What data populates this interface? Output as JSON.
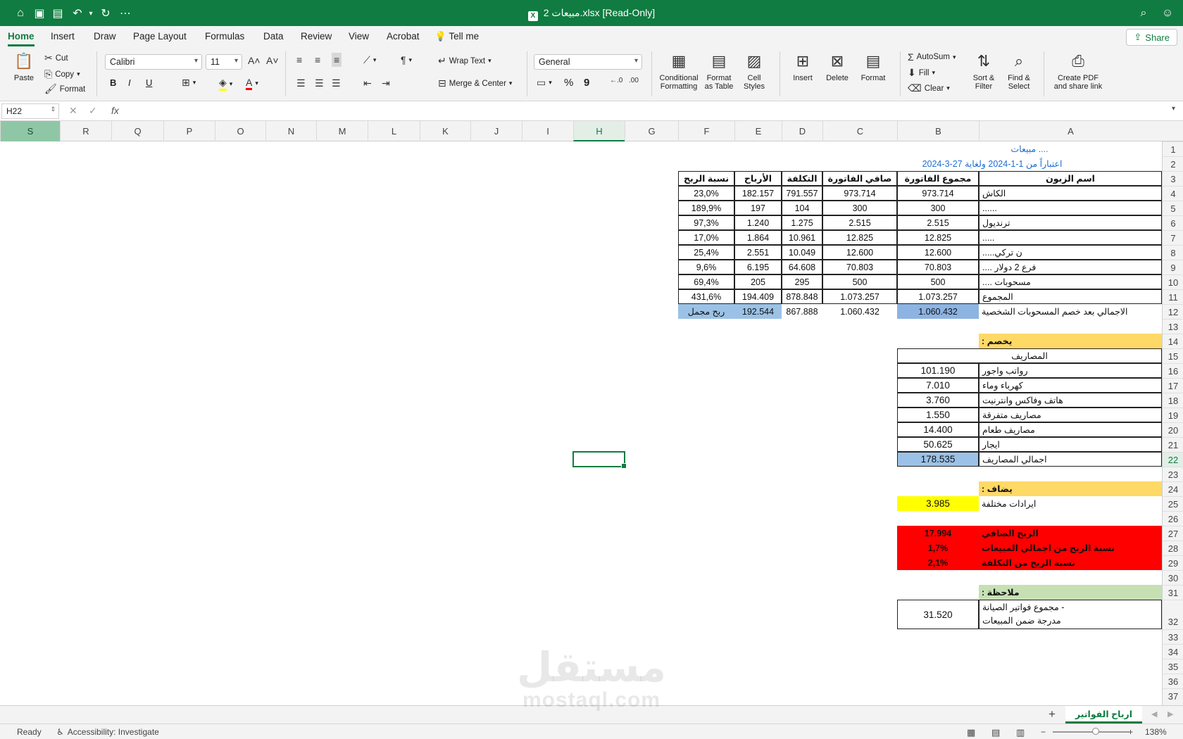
{
  "titlebar": {
    "title": "مبيعات 2.xlsx  [Read-Only]",
    "icons": [
      "home-icon",
      "save-icon",
      "save-as-icon",
      "undo-icon",
      "redo-icon",
      "more-icon",
      "search-icon",
      "account-icon"
    ]
  },
  "menu": {
    "tabs": [
      "Home",
      "Insert",
      "Draw",
      "Page Layout",
      "Formulas",
      "Data",
      "Review",
      "View",
      "Acrobat"
    ],
    "tell_me": "Tell me",
    "share": "Share"
  },
  "ribbon": {
    "paste": "Paste",
    "cut": "Cut",
    "copy": "Copy",
    "format": "Format",
    "font_name": "Calibri",
    "font_size": "11",
    "bold": "B",
    "italic": "I",
    "underline": "U",
    "wrap_text": "Wrap Text",
    "merge_center": "Merge & Center",
    "number_format": "General",
    "percent": "%",
    "comma": "9",
    "conditional_formatting": "Conditional Formatting",
    "format_as_table": "Format as Table",
    "cell_styles": "Cell Styles",
    "insert": "Insert",
    "delete": "Delete",
    "format_cells": "Format",
    "autosum": "AutoSum",
    "fill": "Fill",
    "clear": "Clear",
    "sort_filter": "Sort & Filter",
    "find_select": "Find & Select",
    "create_pdf": "Create PDF and share link"
  },
  "formula": {
    "name_box": "H22",
    "fx": "fx",
    "content": ""
  },
  "columns": [
    "S",
    "R",
    "Q",
    "P",
    "O",
    "N",
    "M",
    "L",
    "K",
    "J",
    "I",
    "H",
    "G",
    "F",
    "E",
    "D",
    "C",
    "B",
    "A"
  ],
  "rows": [
    "1",
    "2",
    "3",
    "4",
    "5",
    "6",
    "7",
    "8",
    "9",
    "10",
    "11",
    "12",
    "13",
    "14",
    "15",
    "16",
    "17",
    "18",
    "19",
    "20",
    "21",
    "22",
    "23",
    "24",
    "25",
    "26",
    "27",
    "28",
    "29",
    "30",
    "31",
    "32",
    "33",
    "34",
    "35",
    "36",
    "37"
  ],
  "selected_cell": "H22",
  "sheet": {
    "title": "مبيعات ....",
    "subtitle": "اعتباراً من  1-1-2024 ولغاية  27-3-2024",
    "headers": [
      "اسم الزبون",
      "مجموع الفاتورة",
      "صافي الفاتورة",
      "التكلفة",
      "الأرباح",
      "نسبة الربح"
    ],
    "sales_rows": [
      [
        "الكاش",
        "973.714",
        "973.714",
        "791.557",
        "182.157",
        "23,0%"
      ],
      [
        "......",
        "300",
        "300",
        "104",
        "197",
        "189,9%"
      ],
      [
        "ترنديول",
        "2.515",
        "2.515",
        "1.275",
        "1.240",
        "97,3%"
      ],
      [
        ".....",
        "12.825",
        "12.825",
        "10.961",
        "1.864",
        "17,0%"
      ],
      [
        "ن تركي.....",
        "12.600",
        "12.600",
        "10.049",
        "2.551",
        "25,4%"
      ],
      [
        "فرع 2 دولار ....",
        "70.803",
        "70.803",
        "64.608",
        "6.195",
        "9,6%"
      ],
      [
        "مسحوبات ....",
        "500",
        "500",
        "295",
        "205",
        "69,4%"
      ],
      [
        "المجموع",
        "1.073.257",
        "1.073.257",
        "878.848",
        "194.409",
        "431,6%"
      ]
    ],
    "net_row": [
      "الاجمالي بعد خصم المسحوبات الشخصية",
      "1.060.432",
      "1.060.432",
      "867.888",
      "192.544",
      "ربح مجمل"
    ],
    "deduct_label": "يخصم :",
    "expenses_header": "المصاريف",
    "expenses": [
      [
        "رواتب واجور",
        "101.190"
      ],
      [
        "كهرباء وماء",
        "7.010"
      ],
      [
        "هاتف وفاكس وانترنيت",
        "3.760"
      ],
      [
        "مصاريف متفرقة",
        "1.550"
      ],
      [
        "مصاريف طعام",
        "14.400"
      ],
      [
        "ايجار",
        "50.625"
      ]
    ],
    "expenses_total": [
      "اجمالي المصاريف",
      "178.535"
    ],
    "add_label": "يضاف :",
    "misc_income": [
      "ايرادات مختلفة",
      "3.985"
    ],
    "net_profit": [
      "الربح الصافي",
      "17.994"
    ],
    "profit_of_sales": [
      "نسبة الربح من اجمالي المبيعات",
      "1,7%"
    ],
    "profit_of_cost": [
      "نسبة الربح من التكلفة",
      "2,1%"
    ],
    "note_label": "ملاحظة :",
    "note_line1": "- مجموع فواتير الصيانة",
    "note_line2": "مدرجة  ضمن المبيعات",
    "note_value": "31.520"
  },
  "sheet_tab": "ارباح الفواتير",
  "status": {
    "ready": "Ready",
    "accessibility": "Accessibility: Investigate",
    "zoom": "138%"
  },
  "watermark": {
    "arabic": "مستقل",
    "latin": "mostaql.com"
  },
  "colors": {
    "accent": "#107c41",
    "header_blue": "#9bc2e6",
    "orange": "#ffd966",
    "yellow": "#ffff00",
    "red": "#ff0000",
    "green_light": "#c6e0b4",
    "title_blue": "#1f6fd1"
  }
}
